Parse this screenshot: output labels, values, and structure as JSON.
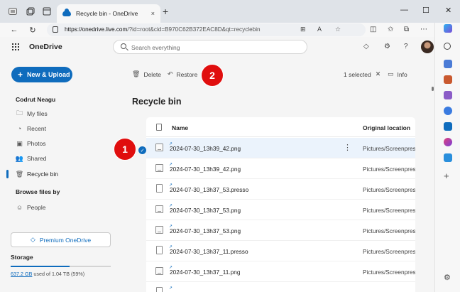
{
  "browser": {
    "tab_title": "Recycle bin - OneDrive",
    "tab_close": "×",
    "new_tab": "+",
    "minimize": "—",
    "maximize": "☐",
    "close": "✕",
    "url_host": "https://onedrive.live.com",
    "url_path": "/?id=root&cid=B970C62B372EAC8D&qt=recyclebin"
  },
  "header": {
    "app_name": "OneDrive",
    "search_placeholder": "Search everything"
  },
  "sidebar": {
    "new_button": "New & Upload",
    "user_name": "Codrut Neagu",
    "items": [
      {
        "label": "My files",
        "icon": "folder-icon"
      },
      {
        "label": "Recent",
        "icon": "clock-icon"
      },
      {
        "label": "Photos",
        "icon": "image-icon"
      },
      {
        "label": "Shared",
        "icon": "people-icon"
      },
      {
        "label": "Recycle bin",
        "icon": "trash-icon",
        "active": true
      }
    ],
    "browse_heading": "Browse files by",
    "people_label": "People",
    "premium_label": "Premium OneDrive",
    "storage_heading": "Storage",
    "storage_used": "637.2 GB",
    "storage_rest": " used of 1.04 TB (59%)",
    "storage_fraction": 0.59
  },
  "commandbar": {
    "delete": "Delete",
    "restore": "Restore",
    "selected_count": "1 selected",
    "info": "Info"
  },
  "callouts": {
    "one": "1",
    "two": "2"
  },
  "main": {
    "title": "Recycle bin",
    "columns": {
      "name": "Name",
      "location": "Original location"
    },
    "rows": [
      {
        "name": "2024-07-30_13h39_42.png",
        "location": "Pictures/Screenpresso",
        "type": "image",
        "selected": true
      },
      {
        "name": "2024-07-30_13h39_42.png",
        "location": "Pictures/Screenpresso",
        "type": "image"
      },
      {
        "name": "2024-07-30_13h37_53.presso",
        "location": "Pictures/Screenpresso",
        "type": "doc"
      },
      {
        "name": "2024-07-30_13h37_53.png",
        "location": "Pictures/Screenpresso",
        "type": "image"
      },
      {
        "name": "2024-07-30_13h37_53.png",
        "location": "Pictures/Screenpresso",
        "type": "image"
      },
      {
        "name": "2024-07-30_13h37_11.presso",
        "location": "Pictures/Screenpresso",
        "type": "doc"
      },
      {
        "name": "2024-07-30_13h37_11.png",
        "location": "Pictures/Screenpresso",
        "type": "image"
      },
      {
        "name": "",
        "location": "",
        "type": "doc"
      }
    ]
  }
}
